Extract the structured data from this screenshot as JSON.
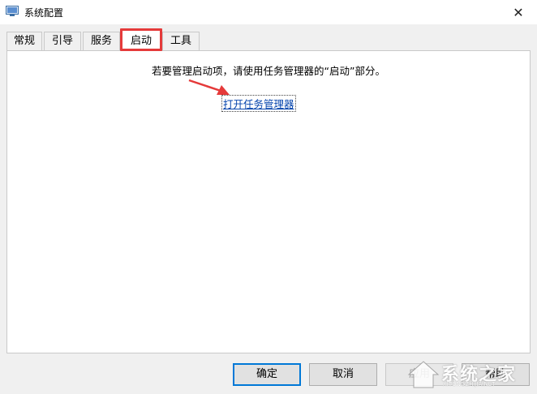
{
  "window": {
    "title": "系统配置",
    "close_glyph": "✕"
  },
  "tabs": [
    {
      "label": "常规"
    },
    {
      "label": "引导"
    },
    {
      "label": "服务"
    },
    {
      "label": "启动",
      "active": true
    },
    {
      "label": "工具"
    }
  ],
  "startup": {
    "info": "若要管理启动项，请使用任务管理器的“启动”部分。",
    "link": "打开任务管理器"
  },
  "buttons": {
    "ok": "确定",
    "cancel": "取消",
    "apply": "应用",
    "help": "帮助"
  },
  "watermark": {
    "text": "系统之家",
    "sub": "XITONGZHIJIA.NET"
  },
  "colors": {
    "highlight": "#e53a3a",
    "arrow": "#e53a3a",
    "link": "#0645ad",
    "focus": "#0078d7"
  },
  "icons": {
    "app": "msconfig-icon",
    "close": "close-icon",
    "annotation": "red-arrow-icon"
  }
}
